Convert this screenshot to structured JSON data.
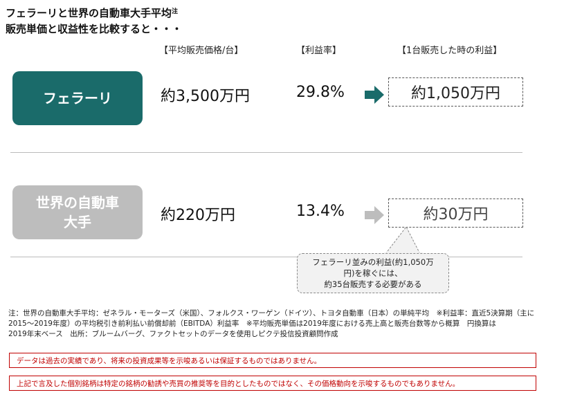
{
  "title": {
    "line1": "フェラーリと世界の自動車大手平均",
    "note_mark": "注",
    "line2": "販売単価と収益性を比較すると・・・"
  },
  "columns": {
    "price": "【平均販売価格/台】",
    "rate": "【利益率】",
    "profit": "【1台販売した時の利益】"
  },
  "rows": [
    {
      "label": "フェラーリ",
      "price": "約3,500万円",
      "rate": "29.8%",
      "profit": "約1,050万円",
      "color": "#1a6b6a",
      "arrow_color": "#1a6b6a"
    },
    {
      "label_line1": "世界の自動車",
      "label_line2": "大手",
      "price": "約220万円",
      "rate": "13.4%",
      "profit": "約30万円",
      "color": "#bdbdbd",
      "arrow_color": "#bdbdbd"
    }
  ],
  "callout": {
    "line1": "フェラーリ並みの利益(約1,050万",
    "line2": "円)を稼ぐには、",
    "line3": "約35台販売する必要がある"
  },
  "note": {
    "line1": "注：世界の自動車大手平均：ゼネラル・モーターズ（米国）、フォルクス・ワーゲン（ドイツ）、トヨタ自動車（日本）の単純平均　※利益率：直近5決算期（主に",
    "line2": "2015～2019年度）の平均税引き前利払い前償却前（EBITDA）利益率　※平均販売単価は2019年度における売上高と販売台数等から概算　円換算は",
    "line3": "2019年末ベース　出所：ブルームバーグ、ファクトセットのデータを使用しピクテ投信投資顧問作成"
  },
  "disclaimers": [
    "データは過去の実績であり、将来の投資成果等を示唆あるいは保証するものではありません。",
    "上記で言及した個別銘柄は特定の銘柄の勧誘や売買の推奨等を目的としたものではなく、その価格動向を示唆するものでもありません。"
  ]
}
